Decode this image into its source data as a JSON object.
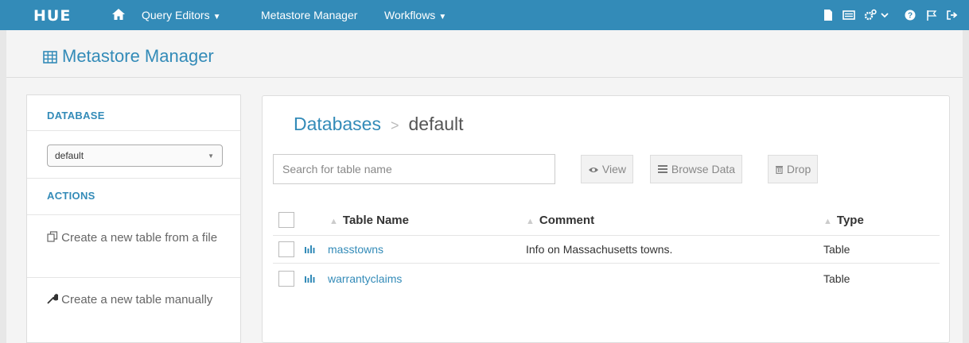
{
  "nav": {
    "logo": "HUE",
    "items": [
      {
        "label": "Query Editors",
        "caret": "⌄"
      },
      {
        "label": "Metastore Manager",
        "caret": ""
      },
      {
        "label": "Workflows",
        "caret": "⌄"
      }
    ],
    "right_icons": [
      "file-icon",
      "list-icon",
      "cogs-icon",
      "chevron-down-icon",
      "help-icon",
      "flag-icon",
      "sign-out-icon"
    ]
  },
  "header": {
    "title": "Metastore Manager",
    "icon": "table-grid-icon"
  },
  "sidebar": {
    "database_heading": "DATABASE",
    "database_selected": "default",
    "actions_heading": "ACTIONS",
    "actions": [
      {
        "label": "Create a new table from a file",
        "icon": "files-icon"
      },
      {
        "label": "Create a new table manually",
        "icon": "wrench-icon"
      }
    ]
  },
  "main": {
    "breadcrumb": {
      "root": "Databases",
      "sep": ">",
      "current": "default"
    },
    "search_placeholder": "Search for table name",
    "buttons": {
      "view": "View",
      "browse": "Browse Data",
      "drop": "Drop"
    },
    "columns": [
      "Table Name",
      "Comment",
      "Type"
    ],
    "rows": [
      {
        "name": "masstowns",
        "comment": "Info on Massachusetts towns.",
        "type": "Table"
      },
      {
        "name": "warrantyclaims",
        "comment": "",
        "type": "Table"
      }
    ]
  },
  "colors": {
    "accent": "#338bb8",
    "nav_bg": "#338bb8"
  }
}
